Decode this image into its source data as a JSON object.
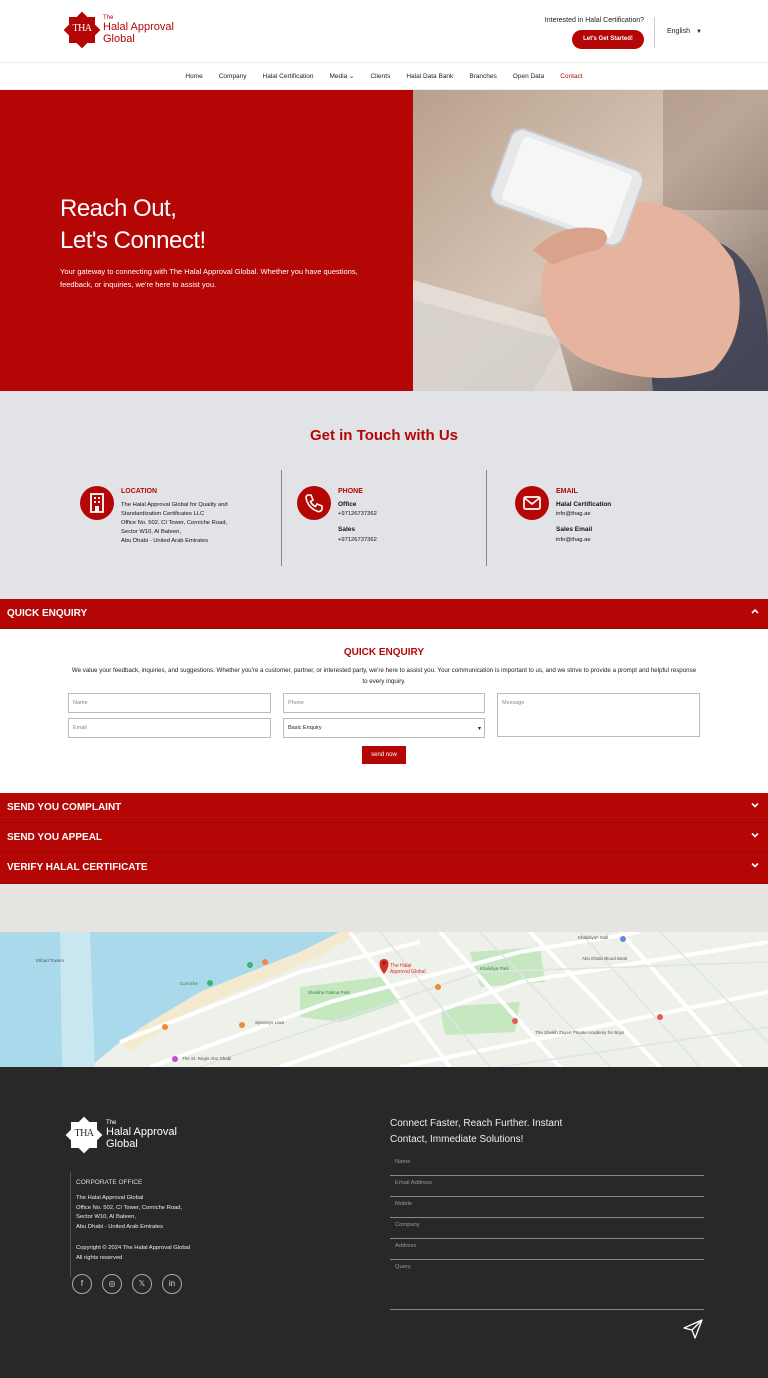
{
  "header": {
    "logo_mark": "THA",
    "logo_the": "The",
    "logo_line1": "Halal Approval",
    "logo_line2": "Global",
    "cta_question": "Interested in Halal Certification?",
    "cta_button": "Let's Get Started!",
    "language": "English"
  },
  "nav": {
    "items": [
      "Home",
      "Company",
      "Halal Certification",
      "Media ⌄",
      "Clients",
      "Halal Data Bank",
      "Branches",
      "Open Data",
      "Contact"
    ],
    "active": "Contact"
  },
  "hero": {
    "title_line1": "Reach Out,",
    "title_line2": "Let's Connect!",
    "subtitle": "Your gateway to connecting with The Halal Approval Global. Whether you have questions, feedback, or inquiries, we're here to assist you."
  },
  "touch": {
    "title": "Get in Touch with Us",
    "location": {
      "heading": "LOCATION",
      "lines": [
        "The Halal Approval Global for Quality and",
        "Standardization Certificates LLC",
        "Office No. 502, CI Tower, Corniche Road,",
        "Sector W10, Al Bateen,",
        "Abu Dhabi - United Arab Emirates"
      ]
    },
    "phone": {
      "heading": "PHONE",
      "office_label": "Office",
      "office_value": "+97126737362",
      "sales_label": "Sales",
      "sales_value": "+97126737362"
    },
    "email": {
      "heading": "EMAIL",
      "cert_label": "Halal Certification",
      "cert_value": "info@thag.ae",
      "sales_label": "Sales Email",
      "sales_value": "info@thag.ae"
    }
  },
  "accordion": {
    "quick_enquiry": "QUICK ENQUIRY",
    "complaint": "SEND YOU COMPLAINT",
    "appeal": "SEND YOU APPEAL",
    "verify": "VERIFY HALAL CERTIFICATE"
  },
  "enquiry": {
    "title": "QUICK ENQUIRY",
    "description": "We value your feedback, inquiries, and suggestions. Whether you're a customer, partner, or interested party, we're here to assist you. Your communication is important to us, and we strive to provide a prompt and helpful response to every inquiry.",
    "name_placeholder": "Name",
    "phone_placeholder": "Phone",
    "message_placeholder": "Message",
    "email_placeholder": "Email",
    "type_selected": "Basic Enquiry",
    "send_label": "send now"
  },
  "map": {
    "pin_label_1": "The Halal",
    "pin_label_2": "Approval Global",
    "labels": [
      "Corniche",
      "Sheikha Fatima Park",
      "Khalidiyah Mall",
      "Abu Dhabi Blood Bank",
      "The Sheikh Zayed Private Academy for Boys",
      "Spinneys Liwa",
      "The St. Regis Abu Dhabi",
      "Khalidiya Park",
      "Etihad Towers"
    ]
  },
  "footer": {
    "logo_mark": "THA",
    "logo_the": "The",
    "logo_line1": "Halal Approval",
    "logo_line2": "Global",
    "office_heading": "CORPORATE OFFICE",
    "address_lines": [
      "The Halal Approval Global",
      "Office No. 502, CI Tower, Corniche Road,",
      "Sector W10, Al Bateen,",
      "Abu Dhabi - United Arab Emirates"
    ],
    "copyright_line1": "Copyright © 2024 The Halal Approval Global",
    "copyright_line2": "All rights reserved",
    "social": [
      "f",
      "◎",
      "𝕏",
      "in"
    ],
    "tagline_line1": "Connect Faster, Reach Further. Instant",
    "tagline_line2": "Contact, Immediate Solutions!",
    "form_fields": [
      "Name",
      "Email Address",
      "Mobile",
      "Company",
      "Address",
      "Query"
    ]
  },
  "colors": {
    "brand": "#b50606",
    "footer_bg": "#282828",
    "touch_bg": "#e1e3e6"
  }
}
